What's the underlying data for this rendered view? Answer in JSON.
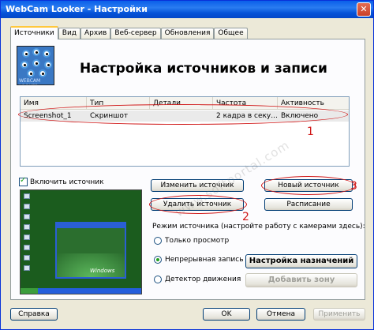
{
  "window": {
    "title": "WebCam Looker - Настройки",
    "close_glyph": "✕"
  },
  "tabs": [
    "Источники",
    "Вид",
    "Архив",
    "Веб-сервер",
    "Обновления",
    "Общее"
  ],
  "logo_text": "WEBCAM LOOKER",
  "heading": "Настройка источников и записи",
  "sources_table": {
    "columns": [
      "Имя",
      "Тип",
      "Детали",
      "Частота",
      "Активность"
    ],
    "rows": [
      {
        "name": "Screenshot_1",
        "type": "Скриншот",
        "details": "",
        "frequency": "2 кадра в секу...",
        "activity": "Включено"
      }
    ]
  },
  "enable_source_label": "Включить источник",
  "preview": {
    "os_label": "Windows"
  },
  "buttons": {
    "edit_source": "Изменить источник",
    "new_source": "Новый источник",
    "delete_source": "Удалить источник",
    "schedule": "Расписание",
    "target_settings": "Настройка назначений",
    "add_zone": "Добавить зону",
    "help": "Справка",
    "ok": "OK",
    "cancel": "Отмена",
    "apply": "Применить"
  },
  "source_mode": {
    "label": "Режим источника (настройте работу с камерами здесь):",
    "options": [
      "Только просмотр",
      "Непрерывная запись",
      "Детектор движения"
    ],
    "selected": "Непрерывная запись"
  },
  "annotations": [
    "1",
    "2",
    "3"
  ],
  "watermark": "www.softportal.com",
  "colors": {
    "titlebar": "#0a5fe9",
    "annotation": "#d01818",
    "active_tab": "#ffc83c"
  }
}
